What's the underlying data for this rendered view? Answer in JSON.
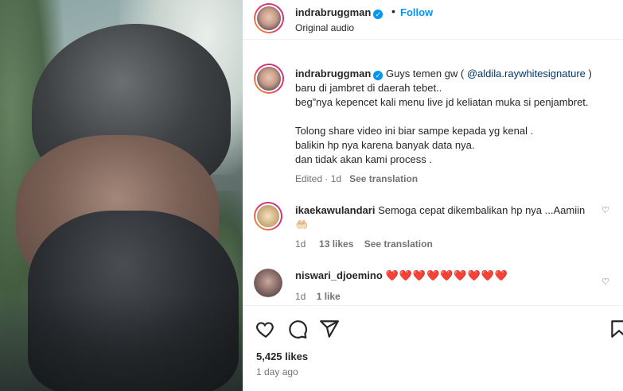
{
  "post": {
    "author": "indrabruggman",
    "follow_label": "Follow",
    "audio": "Original audio",
    "separator": "•"
  },
  "caption": {
    "author": "indrabruggman",
    "lines_1_prefix": "Guys temen gw ( ",
    "mention": "@aldila.raywhitesignature",
    "lines_1_suffix": " )",
    "line2": "baru di jambret di daerah tebet..",
    "line3": "beg”nya kepencet kali menu live jd keliatan muka si penjambret.",
    "line5": "Tolong share video ini biar sampe kepada yg kenal .",
    "line6": "balikin hp nya karena banyak data nya.",
    "line7": "dan tidak akan kami process .",
    "edited": "Edited",
    "time": "1d",
    "see_translation": "See translation",
    "dot": "·"
  },
  "comments": [
    {
      "user": "ikaekawulandari",
      "text": "Semoga cepat dikembalikan hp nya ...Aamiin",
      "emoji": "🤲🏻",
      "time": "1d",
      "likes": "13 likes",
      "see_translation": "See translation"
    },
    {
      "user": "niswari_djoemino",
      "text": "❤️❤️❤️❤️❤️❤️❤️❤️❤️",
      "time": "1d",
      "likes": "1 like"
    }
  ],
  "footer": {
    "likes": "5,425 likes",
    "ago": "1 day ago"
  },
  "icons": {
    "verified": "verified-badge-icon",
    "like": "heart-icon",
    "comment": "comment-bubble-icon",
    "share": "paper-plane-icon",
    "save": "bookmark-icon"
  },
  "colors": {
    "accent": "#0095f6",
    "mention": "#00376b",
    "muted": "#737373",
    "heart": "#ed4956"
  }
}
